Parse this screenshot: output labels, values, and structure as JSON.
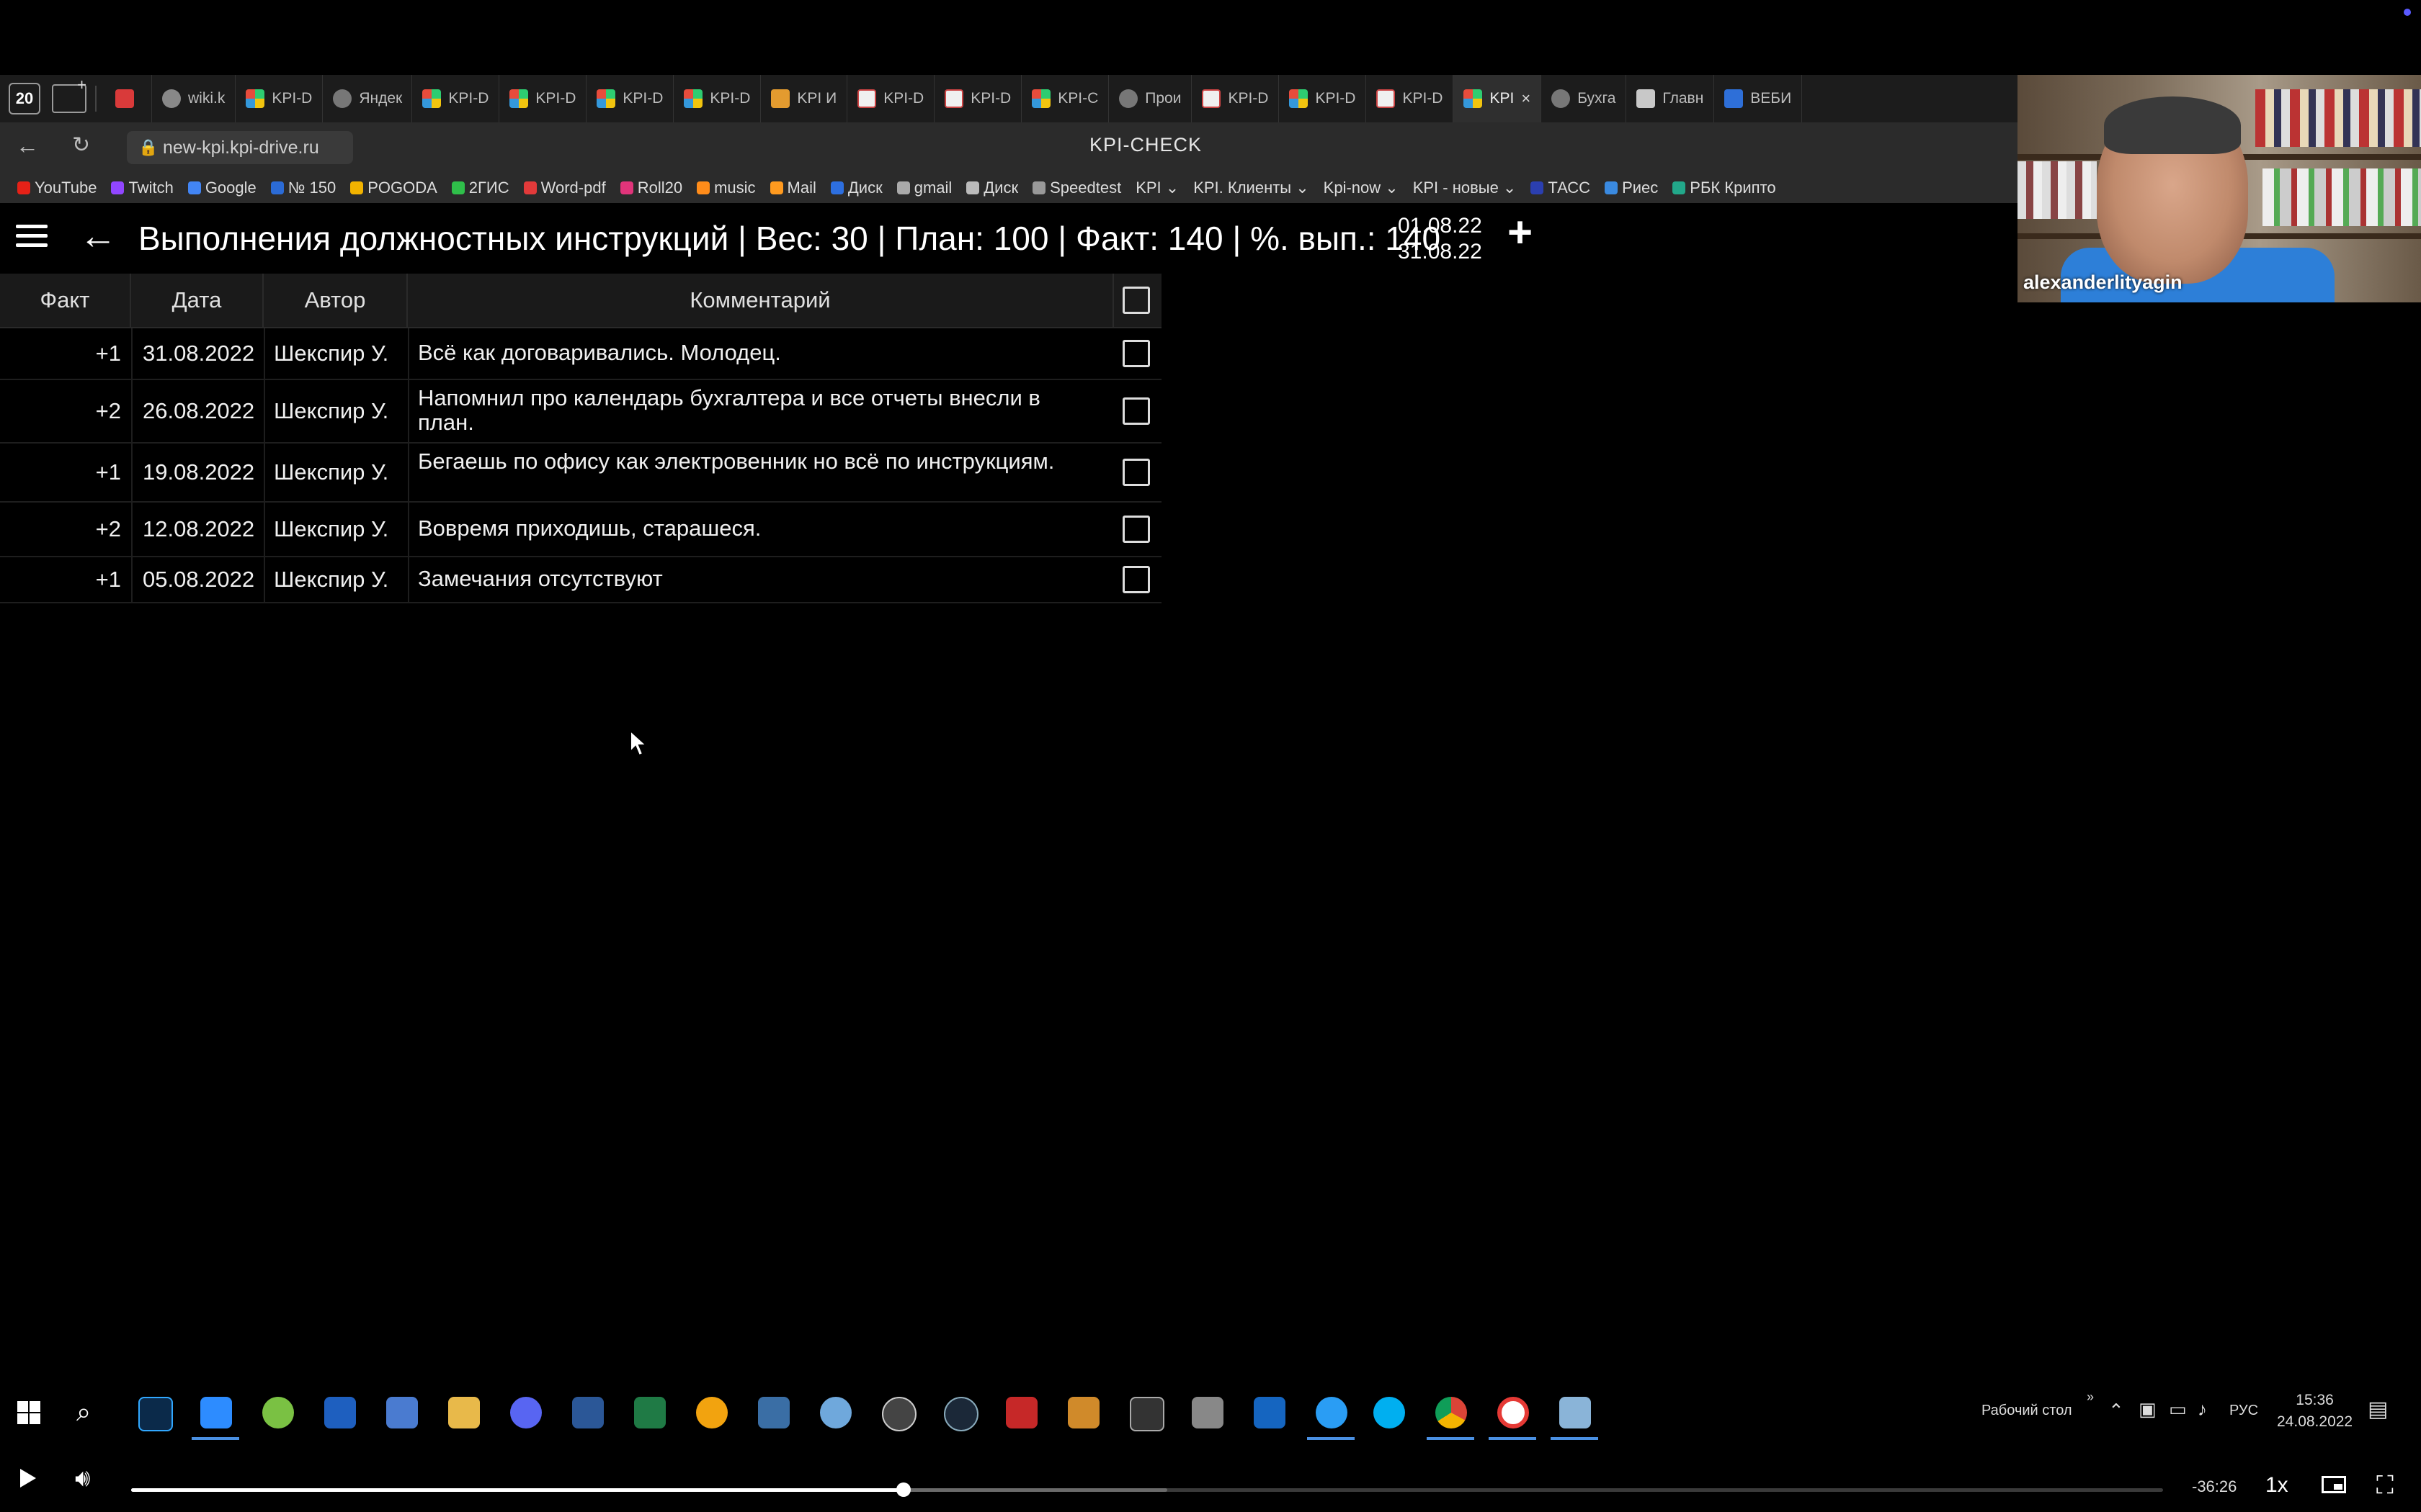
{
  "browser": {
    "tab_count": "20",
    "tabs": [
      {
        "label": "",
        "icon": "red-logo-icon"
      },
      {
        "label": "wiki.k",
        "icon": "wiki-icon"
      },
      {
        "label": "KPI-D",
        "icon": "kpi-icon"
      },
      {
        "label": "Яндек",
        "icon": "yandex-icon"
      },
      {
        "label": "KPI-D",
        "icon": "kpi-icon"
      },
      {
        "label": "KPI-D",
        "icon": "kpi-icon"
      },
      {
        "label": "KPI-D",
        "icon": "kpi-icon"
      },
      {
        "label": "KPI-D",
        "icon": "kpi-icon"
      },
      {
        "label": "KPI И",
        "icon": "mail-icon"
      },
      {
        "label": "KPI-D",
        "icon": "doc-icon"
      },
      {
        "label": "KPI-D",
        "icon": "doc-icon"
      },
      {
        "label": "KPI-C",
        "icon": "kpi-icon"
      },
      {
        "label": "Прои",
        "icon": "circle-icon"
      },
      {
        "label": "KPI-D",
        "icon": "doc-icon"
      },
      {
        "label": "KPI-D",
        "icon": "kpi-icon"
      },
      {
        "label": "KPI-D",
        "icon": "doc-icon"
      },
      {
        "label": "KPI",
        "icon": "kpi-icon",
        "active": true
      },
      {
        "label": "Бухга",
        "icon": "circle-icon"
      },
      {
        "label": "Главн",
        "icon": "gray-icon"
      },
      {
        "label": "ВЕБИ",
        "icon": "blue-icon"
      }
    ],
    "url": "new-kpi.kpi-drive.ru",
    "page_title": "KPI-CHECK",
    "bookmarks": [
      {
        "label": "YouTube",
        "color": "#e62117"
      },
      {
        "label": "Twitch",
        "color": "#9146ff"
      },
      {
        "label": "Google",
        "color": "#4285f4"
      },
      {
        "label": "№ 150",
        "color": "#2b6bd6"
      },
      {
        "label": "POGODA",
        "color": "#f2b300"
      },
      {
        "label": "2ГИС",
        "color": "#2fbf4a"
      },
      {
        "label": "Word-pdf",
        "color": "#e23a3a"
      },
      {
        "label": "Roll20",
        "color": "#e0347a"
      },
      {
        "label": "music",
        "color": "#ff8c1a"
      },
      {
        "label": "Mail",
        "color": "#ff9a1f"
      },
      {
        "label": "Диск",
        "color": "#2d6fe0"
      },
      {
        "label": "gmail",
        "color": "#aaaaaa"
      },
      {
        "label": "Диск",
        "color": "#bbbbbb"
      },
      {
        "label": "Speedtest",
        "color": "#999999"
      },
      {
        "label": "KPI ⌄",
        "color": ""
      },
      {
        "label": "KPI. Клиенты ⌄",
        "color": ""
      },
      {
        "label": "Kpi-now ⌄",
        "color": ""
      },
      {
        "label": "KPI - новые ⌄",
        "color": ""
      },
      {
        "label": "ТАСС",
        "color": "#2b3fb0"
      },
      {
        "label": "Риес",
        "color": "#3a8ae0"
      },
      {
        "label": "РБК Крипто",
        "color": "#22a88a"
      }
    ]
  },
  "app": {
    "title": "Выполнения должностных инструкций | Вес: 30 | План: 100 | Факт: 140 | %. вып.: 140",
    "date_from": "01.08.22",
    "date_to": "31.08.22",
    "add_label": "+"
  },
  "table": {
    "headers": {
      "fact": "Факт",
      "date": "Дата",
      "author": "Автор",
      "comment": "Комментарий"
    },
    "rows": [
      {
        "fact": "+1",
        "date": "31.08.2022",
        "author": "Шекспир У.",
        "comment": "Всё как договаривались. Молодец."
      },
      {
        "fact": "+2",
        "date": "26.08.2022",
        "author": "Шекспир У.",
        "comment": "Напомнил про календарь бухгалтера и все отчеты внесли в план."
      },
      {
        "fact": "+1",
        "date": "19.08.2022",
        "author": "Шекспир У.",
        "comment": "Бегаешь по офису как электровенник но всё по инструкциям."
      },
      {
        "fact": "+2",
        "date": "12.08.2022",
        "author": "Шекспир У.",
        "comment": "Вовремя приходишь, старашеся."
      },
      {
        "fact": "+1",
        "date": "05.08.2022",
        "author": "Шекспир У.",
        "comment": "Замечания отсутствуют"
      }
    ]
  },
  "video_call": {
    "participant": "alexanderlityagin"
  },
  "taskbar": {
    "desktop_label": "Рабочий стол",
    "language": "РУС",
    "time": "15:36",
    "date": "24.08.2022"
  },
  "player": {
    "remaining": "-36:26",
    "speed": "1x",
    "played_fraction": 0.38,
    "buffered_fraction": 0.51
  }
}
